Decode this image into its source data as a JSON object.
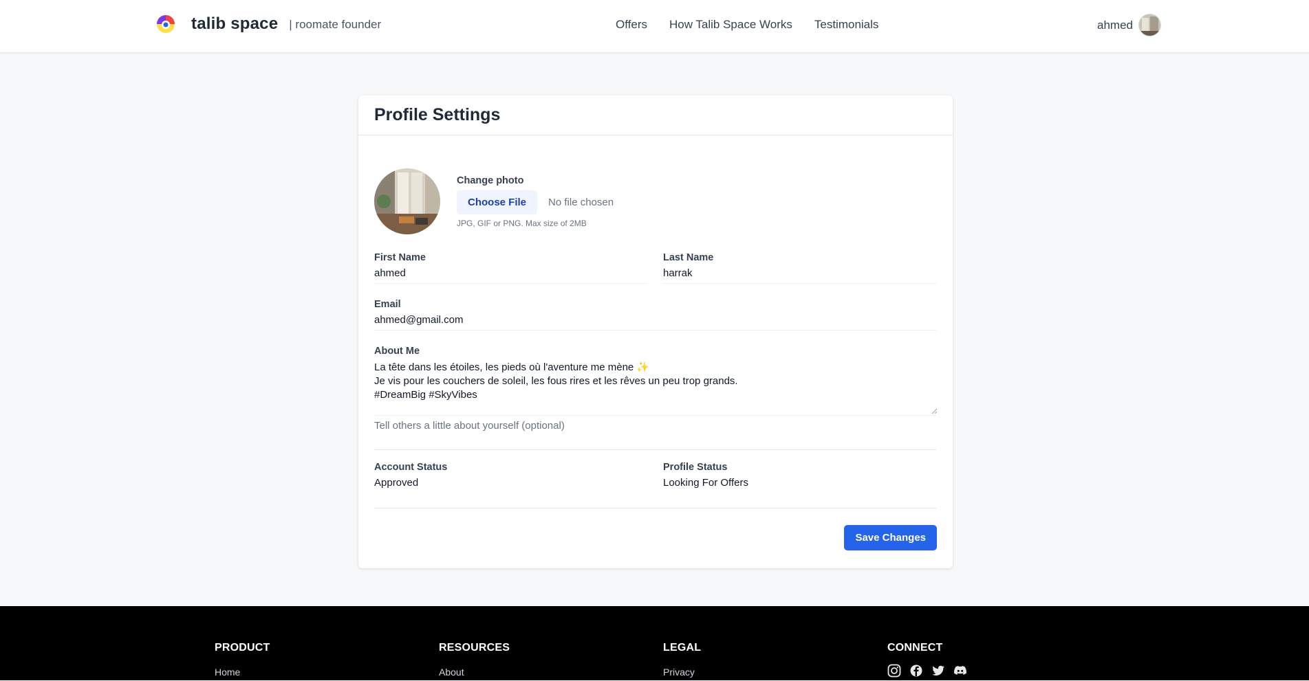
{
  "header": {
    "brand_name": "talib space",
    "brand_tag": "| roomate founder",
    "nav": [
      "Offers",
      "How Talib Space Works",
      "Testimonials"
    ],
    "user_name": "ahmed"
  },
  "profile": {
    "title": "Profile Settings",
    "change_photo_label": "Change photo",
    "choose_file_label": "Choose File",
    "file_status": "No file chosen",
    "photo_hint": "JPG, GIF or PNG. Max size of 2MB",
    "first_name_label": "First Name",
    "first_name": "ahmed",
    "last_name_label": "Last Name",
    "last_name": "harrak",
    "email_label": "Email",
    "email": "ahmed@gmail.com",
    "about_label": "About Me",
    "about_lines": [
      "La tête dans les étoiles, les pieds où l'aventure me mène ✨",
      "Je vis pour les couchers de soleil, les fous rires et les rêves un peu trop grands.",
      "#DreamBig #SkyVibes"
    ],
    "about_help": "Tell others a little about yourself (optional)",
    "account_status_label": "Account Status",
    "account_status": "Approved",
    "profile_status_label": "Profile Status",
    "profile_status": "Looking For Offers",
    "save_label": "Save Changes"
  },
  "footer": {
    "product_head": "PRODUCT",
    "product_link": "Home",
    "resources_head": "RESOURCES",
    "resources_link": "About",
    "legal_head": "LEGAL",
    "legal_link": "Privacy",
    "connect_head": "CONNECT",
    "social_icons": [
      "instagram-icon",
      "facebook-icon",
      "twitter-icon",
      "discord-icon"
    ]
  },
  "colors": {
    "accent": "#2563eb",
    "footer_bg": "#000000",
    "page_bg": "#f7f8fa"
  }
}
